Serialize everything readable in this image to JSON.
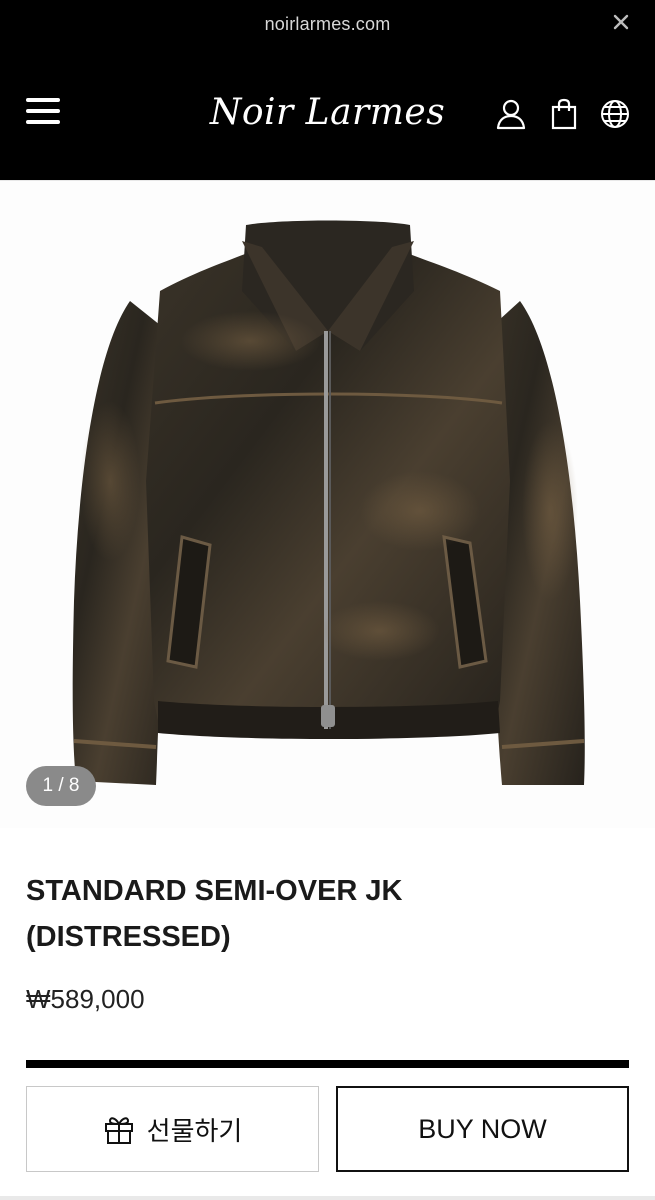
{
  "browser": {
    "url": "noirlarmes.com",
    "close_icon": "close-icon"
  },
  "header": {
    "logo_text": "Noir Larmes",
    "menu_icon": "hamburger-menu-icon",
    "icons": [
      "user-icon",
      "shopping-bag-icon",
      "globe-icon"
    ]
  },
  "gallery": {
    "counter": "1 / 8",
    "image_subject": "distressed leather jacket"
  },
  "product": {
    "title_line1": "STANDARD SEMI-OVER JK",
    "title_line2": "(DISTRESSED)",
    "price": "₩589,000"
  },
  "actions": {
    "gift_label": "선물하기",
    "gift_icon": "gift-icon",
    "buy_label": "BUY NOW"
  },
  "colors": {
    "header_bg": "#000000",
    "accent": "#111111",
    "counter_bg": "#8a8a8a"
  }
}
